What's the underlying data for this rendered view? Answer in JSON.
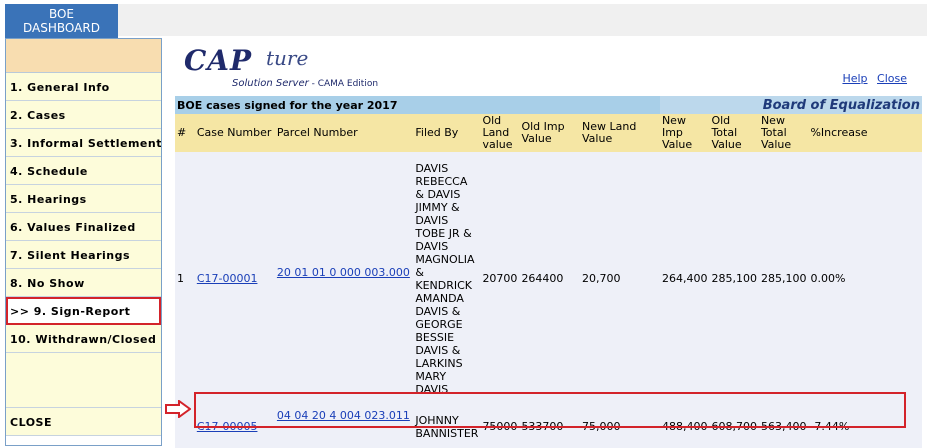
{
  "top": {
    "tab_label_line1": "BOE",
    "tab_label_line2": "DASHBOARD"
  },
  "sidebar": {
    "items": [
      {
        "label": "1. General Info"
      },
      {
        "label": "2. Cases"
      },
      {
        "label": "3. Informal Settlements"
      },
      {
        "label": "4. Schedule"
      },
      {
        "label": "5. Hearings"
      },
      {
        "label": "6. Values Finalized"
      },
      {
        "label": "7. Silent Hearings"
      },
      {
        "label": "8. No Show"
      },
      {
        "label": ">> 9. Sign-Report"
      },
      {
        "label": "10. Withdrawn/Closed"
      }
    ],
    "close_label": "CLOSE"
  },
  "logo": {
    "main": "CAP",
    "script": "ture",
    "sub_line": "Solution Server",
    "sub_suffix": " - CAMA Edition"
  },
  "links": {
    "help": "Help",
    "close": "Close"
  },
  "table": {
    "caption": "BOE cases signed for the year 2017",
    "board_title": "Board of Equalization",
    "headers": [
      "#",
      "Case Number",
      "Parcel Number",
      "Filed By",
      "Old Land value",
      "Old Imp Value",
      "New Land Value",
      "New Imp Value",
      "Old Total Value",
      "New Total Value",
      "%Increase"
    ],
    "rows": [
      {
        "num": "1",
        "case": "C17-00001",
        "parcel": "20 01 01 0 000 003.000",
        "filed_by": "DAVIS REBECCA & DAVIS JIMMY & DAVIS TOBE JR & DAVIS MAGNOLIA & KENDRICK AMANDA DAVIS & GEORGE BESSIE DAVIS & LARKINS MARY DAVIS",
        "old_land": "20700",
        "old_imp": "264400",
        "new_land": "20,700",
        "new_imp": "264,400",
        "old_total": "285,100",
        "new_total": "285,100",
        "pct": "0.00%"
      },
      {
        "num": "",
        "case": "C17-00005",
        "parcel": "04 04 20 4 004 023.011",
        "filed_by": "JOHNNY BANNISTER",
        "old_land": "75000",
        "old_imp": "533700",
        "new_land": "75,000",
        "new_imp": "488,400",
        "old_total": "608,700",
        "new_total": "563,400",
        "pct": "-7.44%"
      }
    ]
  },
  "colors": {
    "accent_blue": "#3a73b8",
    "highlight_red": "#d3232a",
    "header_yellow": "#f5e6a4",
    "caption_blue": "#a8cfe8"
  }
}
